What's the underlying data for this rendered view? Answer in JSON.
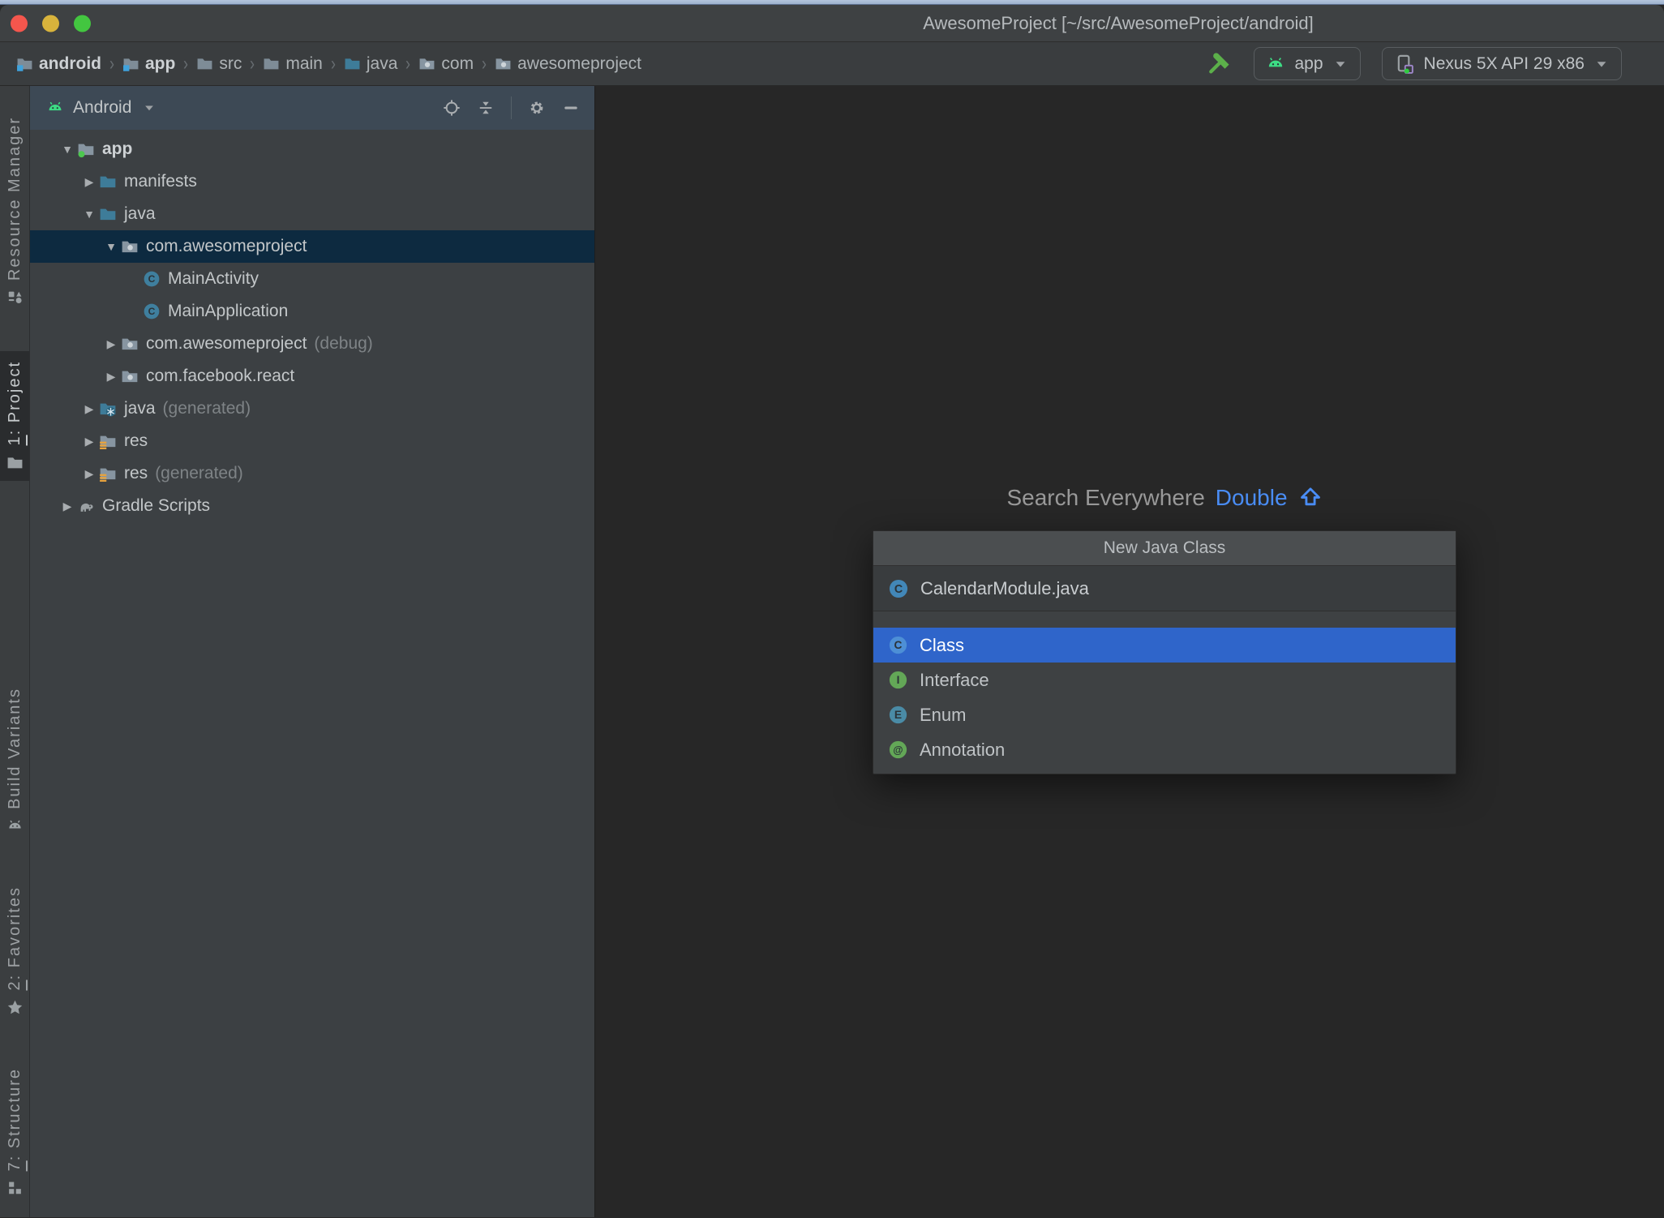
{
  "window": {
    "title": "AwesomeProject [~/src/AwesomeProject/android]"
  },
  "breadcrumbs": {
    "separator": "›",
    "items": [
      {
        "label": "android",
        "icon": "module-folder",
        "bold": true
      },
      {
        "label": "app",
        "icon": "module-folder",
        "bold": true
      },
      {
        "label": "src",
        "icon": "folder",
        "bold": false
      },
      {
        "label": "main",
        "icon": "folder",
        "bold": false
      },
      {
        "label": "java",
        "icon": "folder-src",
        "bold": false
      },
      {
        "label": "com",
        "icon": "package",
        "bold": false
      },
      {
        "label": "awesomeproject",
        "icon": "package",
        "bold": false
      }
    ]
  },
  "toolbar": {
    "run_config": {
      "label": "app"
    },
    "device": {
      "label": "Nexus 5X API 29 x86"
    }
  },
  "tool_strip": {
    "top": [
      {
        "mnemonic": "",
        "label": "Resource Manager",
        "icon": "resource-manager",
        "active": false
      },
      {
        "mnemonic": "1",
        "label": ": Project",
        "icon": "project-folder",
        "active": true
      }
    ],
    "bottom": [
      {
        "mnemonic": "",
        "label": "Build Variants",
        "icon": "android-head-gray",
        "active": false
      },
      {
        "mnemonic": "2",
        "label": ": Favorites",
        "icon": "star",
        "active": false
      },
      {
        "mnemonic": "7",
        "label": ": Structure",
        "icon": "structure",
        "active": false
      }
    ]
  },
  "project_panel": {
    "view_label": "Android",
    "tree": [
      {
        "level": 0,
        "state": "expanded",
        "icon": "module-folder-dot",
        "label": "app",
        "bold": true,
        "selected": false,
        "annotation": ""
      },
      {
        "level": 1,
        "state": "collapsed",
        "icon": "folder-teal",
        "label": "manifests",
        "bold": false,
        "selected": false,
        "annotation": ""
      },
      {
        "level": 1,
        "state": "expanded",
        "icon": "folder-teal",
        "label": "java",
        "bold": false,
        "selected": false,
        "annotation": ""
      },
      {
        "level": 2,
        "state": "expanded",
        "icon": "package",
        "label": "com.awesomeproject",
        "bold": false,
        "selected": true,
        "annotation": ""
      },
      {
        "level": 3,
        "state": "none",
        "icon": "class",
        "label": "MainActivity",
        "bold": false,
        "selected": false,
        "annotation": ""
      },
      {
        "level": 3,
        "state": "none",
        "icon": "class",
        "label": "MainApplication",
        "bold": false,
        "selected": false,
        "annotation": ""
      },
      {
        "level": 2,
        "state": "collapsed",
        "icon": "package",
        "label": "com.awesomeproject",
        "bold": false,
        "selected": false,
        "annotation": "(debug)"
      },
      {
        "level": 2,
        "state": "collapsed",
        "icon": "package",
        "label": "com.facebook.react",
        "bold": false,
        "selected": false,
        "annotation": ""
      },
      {
        "level": 1,
        "state": "collapsed",
        "icon": "folder-generated",
        "label": "java",
        "bold": false,
        "selected": false,
        "annotation": "(generated)"
      },
      {
        "level": 1,
        "state": "collapsed",
        "icon": "folder-res",
        "label": "res",
        "bold": false,
        "selected": false,
        "annotation": ""
      },
      {
        "level": 1,
        "state": "collapsed",
        "icon": "folder-res",
        "label": "res",
        "bold": false,
        "selected": false,
        "annotation": "(generated)"
      },
      {
        "level": 0,
        "state": "collapsed",
        "icon": "gradle",
        "label": "Gradle Scripts",
        "bold": false,
        "selected": false,
        "annotation": ""
      }
    ]
  },
  "editor": {
    "hint_text": "Search Everywhere",
    "shortcut_text": "Double",
    "shortcut_symbol": "shift-arrow"
  },
  "popup": {
    "title": "New Java Class",
    "input_value": "CalendarModule.java",
    "input_icon": "class-mid",
    "options": [
      {
        "label": "Class",
        "icon": "class-bright",
        "selected": true
      },
      {
        "label": "Interface",
        "icon": "interface",
        "selected": false
      },
      {
        "label": "Enum",
        "icon": "enum",
        "selected": false
      },
      {
        "label": "Annotation",
        "icon": "annotation",
        "selected": false
      }
    ]
  },
  "colors": {
    "accent_blue": "#4a8df5",
    "selection_blue": "#2f65ca",
    "tree_selection": "#0d2a40",
    "android_green": "#3ddc84",
    "hammer_green": "#5cb04a",
    "res_orange": "#e8a33d",
    "panel_header": "#3d4955",
    "editor_bg": "#272727"
  }
}
